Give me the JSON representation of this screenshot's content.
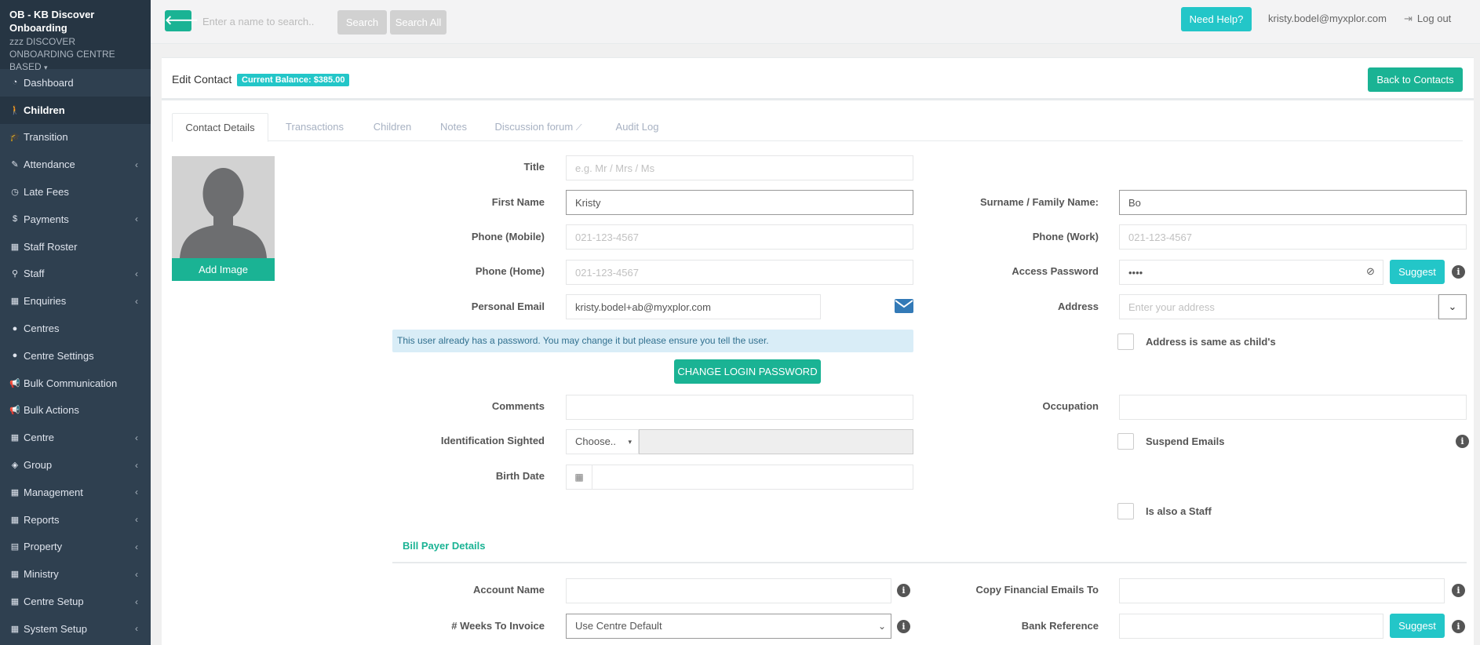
{
  "sidebar": {
    "org_title": "OB - KB Discover Onboarding",
    "centre_name": "zzz DISCOVER ONBOARDING CENTRE BASED",
    "items": [
      {
        "label": "Dashboard",
        "icon": "dashboard-icon",
        "active": false,
        "expandable": false
      },
      {
        "label": "Children",
        "icon": "child-icon",
        "active": true,
        "expandable": false
      },
      {
        "label": "Transition",
        "icon": "graduation-cap-icon",
        "active": false,
        "expandable": false
      },
      {
        "label": "Attendance",
        "icon": "edit-icon",
        "active": false,
        "expandable": true
      },
      {
        "label": "Late Fees",
        "icon": "clock-icon",
        "active": false,
        "expandable": false
      },
      {
        "label": "Payments",
        "icon": "dollar-icon",
        "active": false,
        "expandable": true
      },
      {
        "label": "Staff Roster",
        "icon": "calendar-icon",
        "active": false,
        "expandable": false
      },
      {
        "label": "Staff",
        "icon": "sitemap-icon",
        "active": false,
        "expandable": true
      },
      {
        "label": "Enquiries",
        "icon": "grid-icon",
        "active": false,
        "expandable": true
      },
      {
        "label": "Centres",
        "icon": "circle-icon",
        "active": false,
        "expandable": false
      },
      {
        "label": "Centre Settings",
        "icon": "circle-icon",
        "active": false,
        "expandable": false
      },
      {
        "label": "Bulk Communication",
        "icon": "bullhorn-icon",
        "active": false,
        "expandable": false
      },
      {
        "label": "Bulk Actions",
        "icon": "bullhorn-icon",
        "active": false,
        "expandable": false
      },
      {
        "label": "Centre",
        "icon": "grid-icon",
        "active": false,
        "expandable": true
      },
      {
        "label": "Group",
        "icon": "cube-icon",
        "active": false,
        "expandable": true
      },
      {
        "label": "Management",
        "icon": "grid-icon",
        "active": false,
        "expandable": true
      },
      {
        "label": "Reports",
        "icon": "grid-icon",
        "active": false,
        "expandable": true
      },
      {
        "label": "Property",
        "icon": "building-icon",
        "active": false,
        "expandable": true
      },
      {
        "label": "Ministry",
        "icon": "grid-icon",
        "active": false,
        "expandable": true
      },
      {
        "label": "Centre Setup",
        "icon": "grid-icon",
        "active": false,
        "expandable": true
      },
      {
        "label": "System Setup",
        "icon": "grid-icon",
        "active": false,
        "expandable": true
      }
    ]
  },
  "topbar": {
    "search_placeholder": "Enter a name to search..",
    "search_label": "Search",
    "search_all_label": "Search All",
    "help_label": "Need Help?",
    "user_email": "kristy.bodel@myxplor.com",
    "logout_label": "Log out"
  },
  "header": {
    "title": "Edit Contact",
    "balance": "Current Balance: $385.00",
    "back_label": "Back to Contacts"
  },
  "tabs": [
    {
      "label": "Contact Details",
      "active": true
    },
    {
      "label": "Transactions",
      "active": false
    },
    {
      "label": "Children",
      "active": false
    },
    {
      "label": "Notes",
      "active": false
    },
    {
      "label": "Discussion forum",
      "active": false
    },
    {
      "label": "Audit Log",
      "active": false
    }
  ],
  "avatar": {
    "add_image_label": "Add Image"
  },
  "form": {
    "title": {
      "label": "Title",
      "value": "",
      "placeholder": "e.g. Mr / Mrs / Ms"
    },
    "first_name": {
      "label": "First Name",
      "value": "Kristy"
    },
    "surname": {
      "label": "Surname / Family Name:",
      "value": "Bo"
    },
    "phone_mobile": {
      "label": "Phone (Mobile)",
      "value": "",
      "placeholder": "021-123-4567"
    },
    "phone_work": {
      "label": "Phone (Work)",
      "value": "",
      "placeholder": "021-123-4567"
    },
    "phone_home": {
      "label": "Phone (Home)",
      "value": "",
      "placeholder": "021-123-4567"
    },
    "access_password": {
      "label": "Access Password",
      "value": "••••",
      "suggest_label": "Suggest"
    },
    "personal_email": {
      "label": "Personal Email",
      "value": "kristy.bodel+ab@myxplor.com"
    },
    "address": {
      "label": "Address",
      "value": "",
      "placeholder": "Enter your address"
    },
    "password_notice": "This user already has a password. You may change it but please ensure you tell the user.",
    "address_same": {
      "label": "Address is same as child's",
      "checked": false
    },
    "change_password_label": "CHANGE LOGIN PASSWORD",
    "comments": {
      "label": "Comments",
      "value": ""
    },
    "occupation": {
      "label": "Occupation",
      "value": ""
    },
    "identification": {
      "label": "Identification Sighted",
      "selected": "Choose..",
      "value": ""
    },
    "suspend_emails": {
      "label": "Suspend Emails",
      "checked": false
    },
    "birth_date": {
      "label": "Birth Date",
      "value": ""
    },
    "also_staff": {
      "label": "Is also a Staff",
      "checked": false
    }
  },
  "bill_payer": {
    "section_title": "Bill Payer Details",
    "account_name": {
      "label": "Account Name",
      "value": ""
    },
    "copy_emails": {
      "label": "Copy Financial Emails To",
      "value": ""
    },
    "weeks_to_invoice": {
      "label": "# Weeks To Invoice",
      "selected": "Use Centre Default"
    },
    "bank_reference": {
      "label": "Bank Reference",
      "value": "",
      "suggest_label": "Suggest"
    }
  },
  "colors": {
    "sidebar_bg": "#2f4050",
    "primary_green": "#1ab394",
    "info_teal": "#23c6c8",
    "section_accent": "#1ab394"
  }
}
